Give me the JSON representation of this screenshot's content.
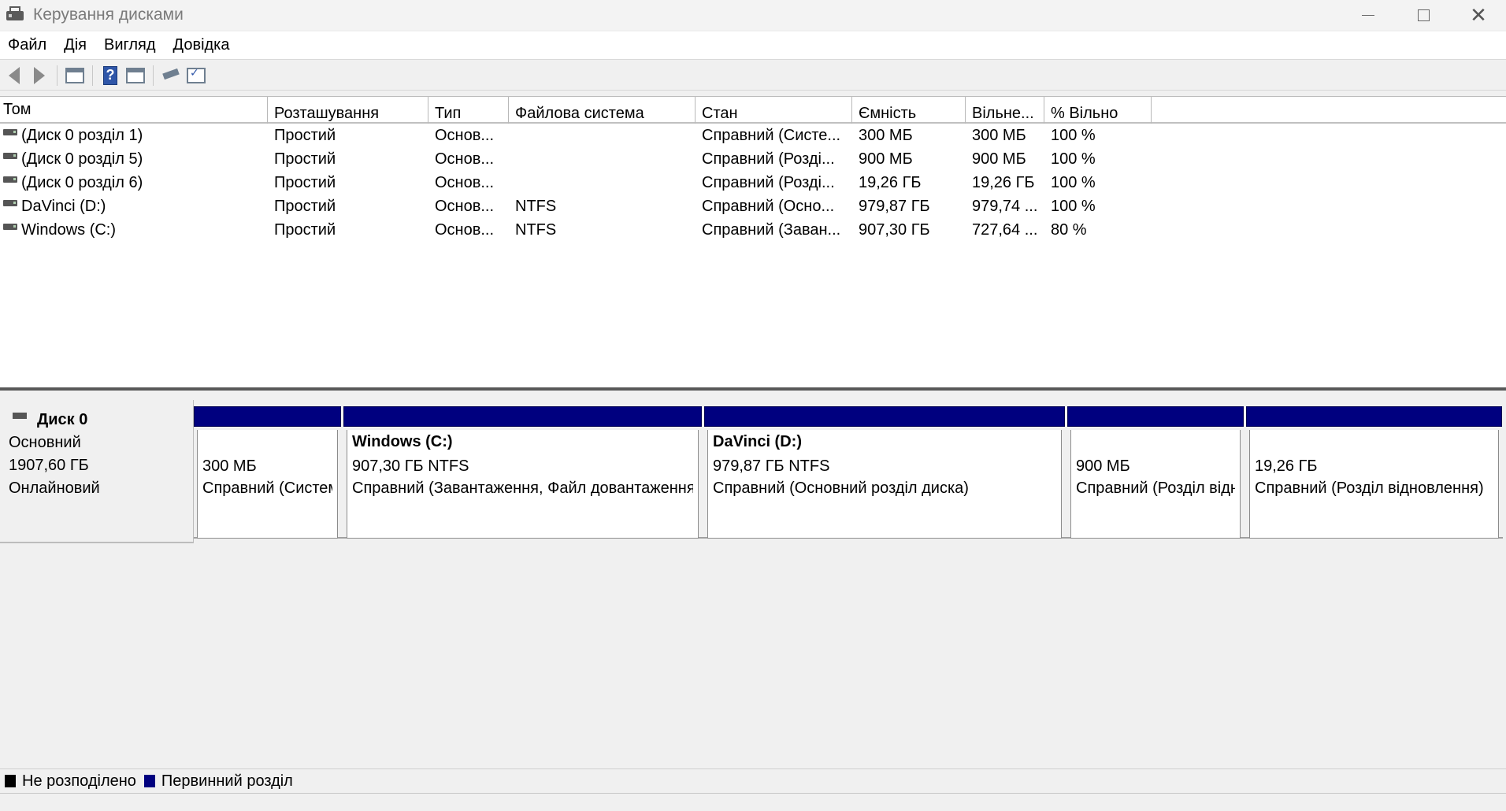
{
  "window": {
    "title": "Керування дисками"
  },
  "menu": {
    "items": [
      "Файл",
      "Дія",
      "Вигляд",
      "Довідка"
    ]
  },
  "toolbar": {
    "icons": [
      "back-arrow-icon",
      "forward-arrow-icon",
      "console-tree-icon",
      "help-icon",
      "action-pane-icon",
      "connect-icon",
      "properties-icon"
    ]
  },
  "volume_list": {
    "columns": [
      "Том",
      "Розташування",
      "Тип",
      "Файлова система",
      "Стан",
      "Ємність",
      "Вільне...",
      "% Вільно"
    ],
    "rows": [
      {
        "tom": "(Диск 0 розділ 1)",
        "loc": "Простий",
        "type": "Основ...",
        "fs": "",
        "state": "Справний (Систе...",
        "cap": "300 МБ",
        "free": "300 МБ",
        "pct": "100 %"
      },
      {
        "tom": "(Диск 0 розділ 5)",
        "loc": "Простий",
        "type": "Основ...",
        "fs": "",
        "state": "Справний (Розді...",
        "cap": "900 МБ",
        "free": "900 МБ",
        "pct": "100 %"
      },
      {
        "tom": "(Диск 0 розділ 6)",
        "loc": "Простий",
        "type": "Основ...",
        "fs": "",
        "state": "Справний (Розді...",
        "cap": "19,26 ГБ",
        "free": "19,26 ГБ",
        "pct": "100 %"
      },
      {
        "tom": "DaVinci (D:)",
        "loc": "Простий",
        "type": "Основ...",
        "fs": "NTFS",
        "state": "Справний (Осно...",
        "cap": "979,87 ГБ",
        "free": "979,74 ...",
        "pct": "100 %"
      },
      {
        "tom": "Windows (C:)",
        "loc": "Простий",
        "type": "Основ...",
        "fs": "NTFS",
        "state": "Справний (Заван...",
        "cap": "907,30 ГБ",
        "free": "727,64 ...",
        "pct": "80 %"
      }
    ]
  },
  "disk": {
    "name": "Диск 0",
    "kind": "Основний",
    "size": "1907,60 ГБ",
    "status": "Онлайновий",
    "partitions": [
      {
        "title": "",
        "size": "300 МБ",
        "state": "Справний (Системний розділ EFI)"
      },
      {
        "title": "Windows  (C:)",
        "size": "907,30 ГБ NTFS",
        "state": "Справний (Завантаження, Файл довантаження)"
      },
      {
        "title": "DaVinci  (D:)",
        "size": "979,87 ГБ NTFS",
        "state": "Справний (Основний розділ диска)"
      },
      {
        "title": "",
        "size": "900 МБ",
        "state": "Справний (Розділ відновлення)"
      },
      {
        "title": "",
        "size": "19,26 ГБ",
        "state": "Справний (Розділ відновлення)"
      }
    ]
  },
  "legend": {
    "items": [
      {
        "label": "Не розподілено",
        "color": "#000000"
      },
      {
        "label": "Первинний розділ",
        "color": "#00007f"
      }
    ]
  },
  "colors": {
    "primary_partition": "#00007f",
    "unallocated": "#000000"
  }
}
